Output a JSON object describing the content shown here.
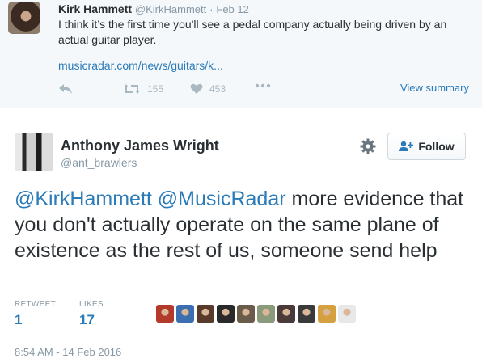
{
  "top_tweet": {
    "name": "Kirk Hammett",
    "handle": "@KirkHammett",
    "separator": "·",
    "date": "Feb 12",
    "text": "I think it’s the first time you'll see a pedal company actually being driven by an actual guitar player.",
    "link": "musicradar.com/news/guitars/k...",
    "retweets": "155",
    "likes": "453",
    "view_summary": "View summary"
  },
  "main_tweet": {
    "name": "Anthony James Wright",
    "handle": "@ant_brawlers",
    "follow_label": "Follow",
    "mention_1": "@KirkHammett",
    "mention_2": "@MusicRadar",
    "text": " more evidence that you don't actually operate on the same plane of existence as the rest of us, someone send help",
    "retweet_label": "RETWEET",
    "retweet_count": "1",
    "likes_label": "LIKES",
    "likes_count": "17",
    "timestamp": "8:54 AM - 14 Feb 2016",
    "liker_avatar_colors": [
      "#b33a2a",
      "#3b6fb0",
      "#5a3a2a",
      "#2a2a2a",
      "#6b5b4b",
      "#8a9a7a",
      "#4a3a3a",
      "#3a3a3a",
      "#d4a040",
      "#e8e8e8"
    ]
  },
  "colors": {
    "link": "#2b7bb9",
    "muted": "#8899a6",
    "background_top": "#f5f8fa"
  }
}
